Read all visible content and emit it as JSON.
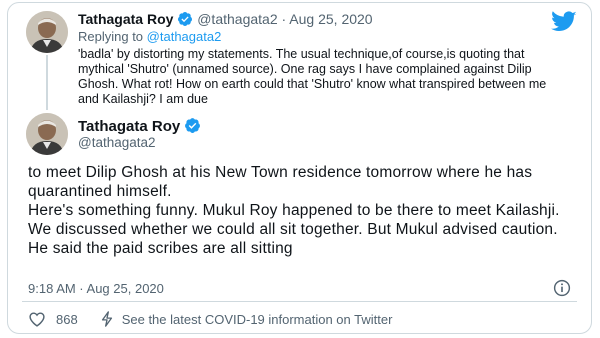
{
  "parent_tweet": {
    "author_name": "Tathagata Roy",
    "handle": "@tathagata2",
    "separator": "·",
    "date": "Aug 25, 2020",
    "replying_prefix": "Replying to",
    "replying_handle": "@tathagata2",
    "text": "'badla' by distorting my statements. The usual technique,of course,is quoting that mythical 'Shutro' (unnamed source). One rag says I have complained against Dilip Ghosh. What rot! How on earth could that 'Shutro' know what transpired between me and Kailashji? I am due"
  },
  "main_tweet": {
    "author_name": "Tathagata Roy",
    "handle": "@tathagata2",
    "text_lines": [
      "to meet Dilip Ghosh at his New Town residence tomorrow where he has quarantined himself.",
      "Here's something funny. Mukul Roy happened to be there to meet Kailashji. We discussed whether we could all sit together. But Mukul advised caution. He said the paid scribes are all sitting"
    ],
    "timestamp": "9:18 AM · Aug 25, 2020"
  },
  "footer": {
    "like_count": "868",
    "covid_notice": "See the latest COVID-19 information on Twitter"
  },
  "colors": {
    "verified_blue": "#1d9bf0",
    "text_primary": "#0f1419",
    "text_muted": "#536471",
    "border": "#cfd9de"
  },
  "icons": {
    "brand": "twitter-bird-icon",
    "verified": "verified-badge-icon",
    "info": "info-icon",
    "like": "heart-icon",
    "covid": "lightning-icon"
  }
}
